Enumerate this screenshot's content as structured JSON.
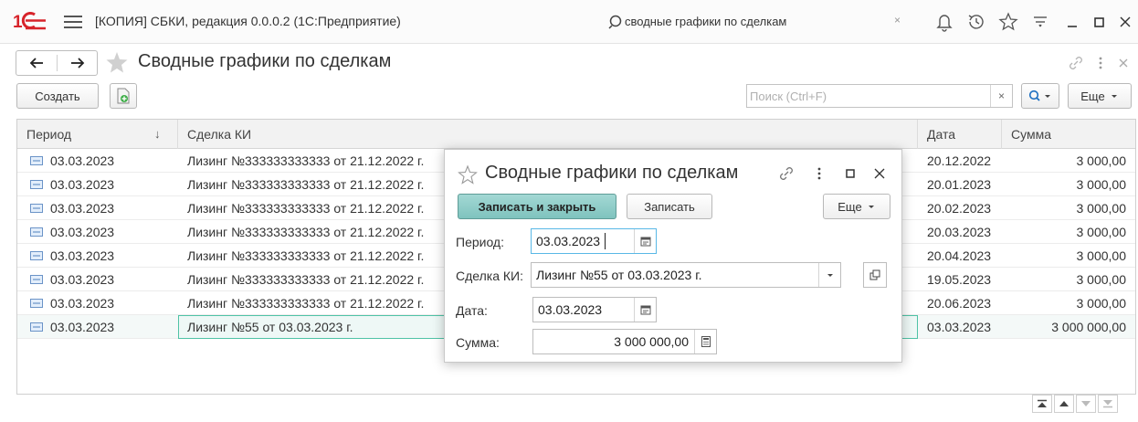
{
  "app": {
    "title": "[КОПИЯ] СБКИ, редакция 0.0.0.2  (1С:Предприятие)",
    "search_value": "сводные графики по сделкам",
    "search_clear": "×"
  },
  "form": {
    "title": "Сводные графики по сделкам",
    "create_label": "Создать",
    "search_placeholder": "Поиск (Ctrl+F)",
    "search_clear": "×",
    "more_label": "Еще",
    "sort_arrow": "↓"
  },
  "table": {
    "columns": [
      "Период",
      "Сделка КИ",
      "Дата",
      "Сумма"
    ],
    "rows": [
      {
        "period": "03.03.2023",
        "deal": "Лизинг №333333333333 от 21.12.2022 г.",
        "date": "20.12.2022",
        "sum": "3 000,00"
      },
      {
        "period": "03.03.2023",
        "deal": "Лизинг №333333333333 от 21.12.2022 г.",
        "date": "20.01.2023",
        "sum": "3 000,00"
      },
      {
        "period": "03.03.2023",
        "deal": "Лизинг №333333333333 от 21.12.2022 г.",
        "date": "20.02.2023",
        "sum": "3 000,00"
      },
      {
        "period": "03.03.2023",
        "deal": "Лизинг №333333333333 от 21.12.2022 г.",
        "date": "20.03.2023",
        "sum": "3 000,00"
      },
      {
        "period": "03.03.2023",
        "deal": "Лизинг №333333333333 от 21.12.2022 г.",
        "date": "20.04.2023",
        "sum": "3 000,00"
      },
      {
        "period": "03.03.2023",
        "deal": "Лизинг №333333333333 от 21.12.2022 г.",
        "date": "19.05.2023",
        "sum": "3 000,00"
      },
      {
        "period": "03.03.2023",
        "deal": "Лизинг №333333333333 от 21.12.2022 г.",
        "date": "20.06.2023",
        "sum": "3 000,00"
      },
      {
        "period": "03.03.2023",
        "deal": "Лизинг №55 от 03.03.2023 г.",
        "date": "03.03.2023",
        "sum": "3 000 000,00"
      }
    ]
  },
  "dialog": {
    "title": "Сводные графики по сделкам",
    "save_close_label": "Записать и закрыть",
    "save_label": "Записать",
    "more_label": "Еще",
    "period_label": "Период:",
    "period_value": "03.03.2023",
    "deal_label": "Сделка КИ:",
    "deal_value": "Лизинг №55 от 03.03.2023 г.",
    "date_label": "Дата:",
    "date_value": "03.03.2023",
    "sum_label": "Сумма:",
    "sum_value": "3 000 000,00"
  },
  "colors": {
    "brand_red": "#d7242b",
    "primary_button": "#8fcdc8",
    "selected_row": "#eef8f6"
  }
}
